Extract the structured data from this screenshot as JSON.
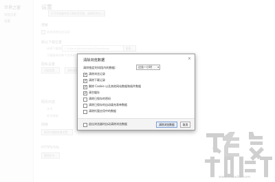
{
  "app": {
    "title": "世界之窗"
  },
  "sidebar": {
    "items": [
      "浏览历史",
      "设置"
    ]
  },
  "settings": {
    "title": "设置",
    "lines": [
      "打开浏览器时显示新标签页面，或继续浏览上次打开的网页",
      "搜索",
      "启用浏览历史记录",
      "默认下载位置",
      "选择下载保存位置",
      "C:\\Users\\Administrator\\Downloads",
      "更改...",
      "下载前询问每个文件的保存位置",
      "隐私设置",
      "内容设置...",
      "清除浏览数据...",
      "网页内容",
      "字号",
      "网页缩放",
      "网络",
      "更改代理服务器设置...",
      "HTTPS/SSL",
      "管理证书..."
    ]
  },
  "dialog": {
    "title": "清除浏览数据",
    "close": "×",
    "range_label": "清除指定时间段内的数据：",
    "range_value": "过去一小时",
    "options": [
      {
        "label": "清除浏览记录",
        "checked": true
      },
      {
        "label": "清除下载记录",
        "checked": true
      },
      {
        "label": "删除 Cookie 以及其他网站数据和插件数据",
        "checked": true
      },
      {
        "label": "清空缓存",
        "checked": true
      },
      {
        "label": "清除已保存的密码",
        "checked": false
      },
      {
        "label": "清除已保存的自动填充表单数据",
        "checked": false
      },
      {
        "label": "清除托管应用中的数据",
        "checked": false
      }
    ],
    "footer_option": {
      "label": "退出浏览器时自动清除浏览数据",
      "checked": false
    },
    "clear_button": "清除浏览数据",
    "cancel_button": "取消",
    "check_mark": "✔"
  },
  "watermark": {
    "url": "www.xiazaiba.com"
  },
  "colors": {
    "accent": "#7a9fd4",
    "watermark": "#c6c6c6"
  }
}
